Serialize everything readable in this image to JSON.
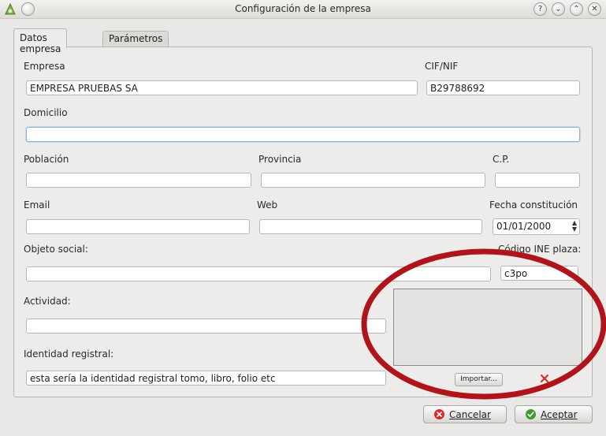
{
  "window": {
    "title": "Configuración de la empresa",
    "buttons": {
      "help": "?",
      "roll": "⌄",
      "maximize": "⌃",
      "close": "✕"
    }
  },
  "tabs": [
    {
      "label": "Datos empresa"
    },
    {
      "label": "Parámetros"
    }
  ],
  "form": {
    "empresa": {
      "label": "Empresa",
      "value": "EMPRESA PRUEBAS SA"
    },
    "cif": {
      "label": "CIF/NIF",
      "value": "B29788692"
    },
    "domicilio": {
      "label": "Domicilio",
      "value": ""
    },
    "poblacion": {
      "label": "Población",
      "value": ""
    },
    "provincia": {
      "label": "Provincia",
      "value": ""
    },
    "cp": {
      "label": "C.P.",
      "value": ""
    },
    "email": {
      "label": "Email",
      "value": ""
    },
    "web": {
      "label": "Web",
      "value": ""
    },
    "fecha": {
      "label": "Fecha constitución",
      "value": "01/01/2000"
    },
    "objeto": {
      "label": "Objeto social:",
      "value": ""
    },
    "ine": {
      "label": "Código INE plaza:",
      "value": "c3po"
    },
    "actividad": {
      "label": "Actividad:",
      "value": ""
    },
    "identidad": {
      "label": "Identidad registral:",
      "value": "esta sería la identidad registral tomo, libro, folio etc"
    }
  },
  "logo": {
    "import_label": "Importar..."
  },
  "footer": {
    "cancel_label": "Cancelar",
    "accept_label": "Aceptar"
  },
  "colors": {
    "annotation_ellipse": "#b0141b",
    "cancel_icon": "#d42a2a",
    "accept_icon": "#3f9a2f"
  }
}
